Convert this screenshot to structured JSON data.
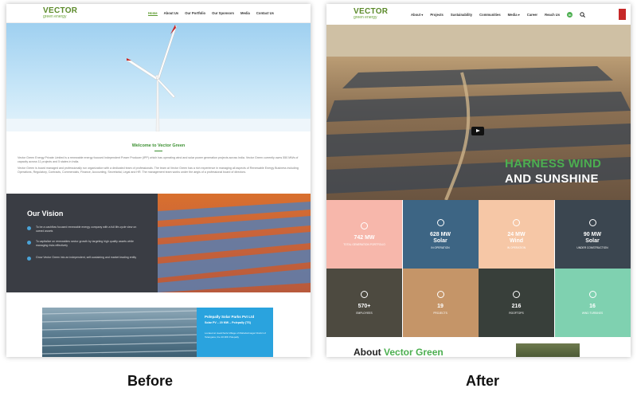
{
  "before": {
    "logo": {
      "title": "VECTOR",
      "subtitle": "green energy"
    },
    "nav": [
      "Home",
      "About Us",
      "Our Portfolio",
      "Our Sponsors",
      "Media",
      "Contact Us"
    ],
    "welcome_title": "Welcome to Vector Green",
    "welcome_p1": "Vector Green Energy Private Limited is a renewable energy focused Independent Power Producer (IPP) which has operating wind and solar power generation projects across India. Vector Green currently owns 550 MWs of capacity across 11 projects and 5 states in India.",
    "welcome_p2": "Vector Green is board managed and professionally run organization with a dedicated team of professionals. The team at Vector Green has a rich experience in managing all aspects of Renewable Energy Business including Operations, Regulatory, Contracts, Commercials, Finance, Accounting, Secretarial, Legal and HR. The management team works under the aegis of a professional board of directors.",
    "vision_title": "Our Vision",
    "vision_items": [
      "To be a cashflow focused renewable energy company with a full life-cycle view on owned assets",
      "To capitalize on renewables sector growth by targeting high quality assets while managing risks effectively",
      "Grow Vector Green into an independent, self-sustaining and market leading entity"
    ],
    "park": {
      "name": "Polepally Solar Parks Pvt Ltd",
      "spec": "Solar PV – 20 MW – Polepally (TS)",
      "desc": "Located at Jeedcherla Village of Mahabubnagar District of Telangana, the 20 MW Polepally"
    }
  },
  "after": {
    "logo": {
      "title": "VECTOR",
      "subtitle": "green energy"
    },
    "nav": [
      "About ▾",
      "Projects",
      "Sustainability",
      "Communities",
      "Media ▾",
      "Career",
      "Reach Us"
    ],
    "social_icon": "in",
    "hero": {
      "line1": "HARNESS WIND",
      "line2": "AND SUNSHINE"
    },
    "stats": [
      {
        "value": "742 MW",
        "label": "TOTAL GENERATION PORTFOLIO",
        "bg": "#f7b7ab"
      },
      {
        "value": "628 MW\nSolar",
        "label": "IN OPERATION",
        "bg": "#3d6584"
      },
      {
        "value": "24 MW\nWind",
        "label": "IN OPERATION",
        "bg": "#f6c7a6"
      },
      {
        "value": "90 MW\nSolar",
        "label": "UNDER CONSTRUCTION",
        "bg": "#3b4650"
      },
      {
        "value": "570+",
        "label": "EMPLOYEES",
        "bg": "#4d4a40"
      },
      {
        "value": "19",
        "label": "PROJECTS",
        "bg": "#c59568"
      },
      {
        "value": "216",
        "label": "ROOFTOPS",
        "bg": "#383f3a"
      },
      {
        "value": "16",
        "label": "WIND TURBINES",
        "bg": "#7fd1b0"
      }
    ],
    "about_title": "About",
    "about_brand": "Vector Green"
  },
  "captions": {
    "before": "Before",
    "after": "After"
  }
}
